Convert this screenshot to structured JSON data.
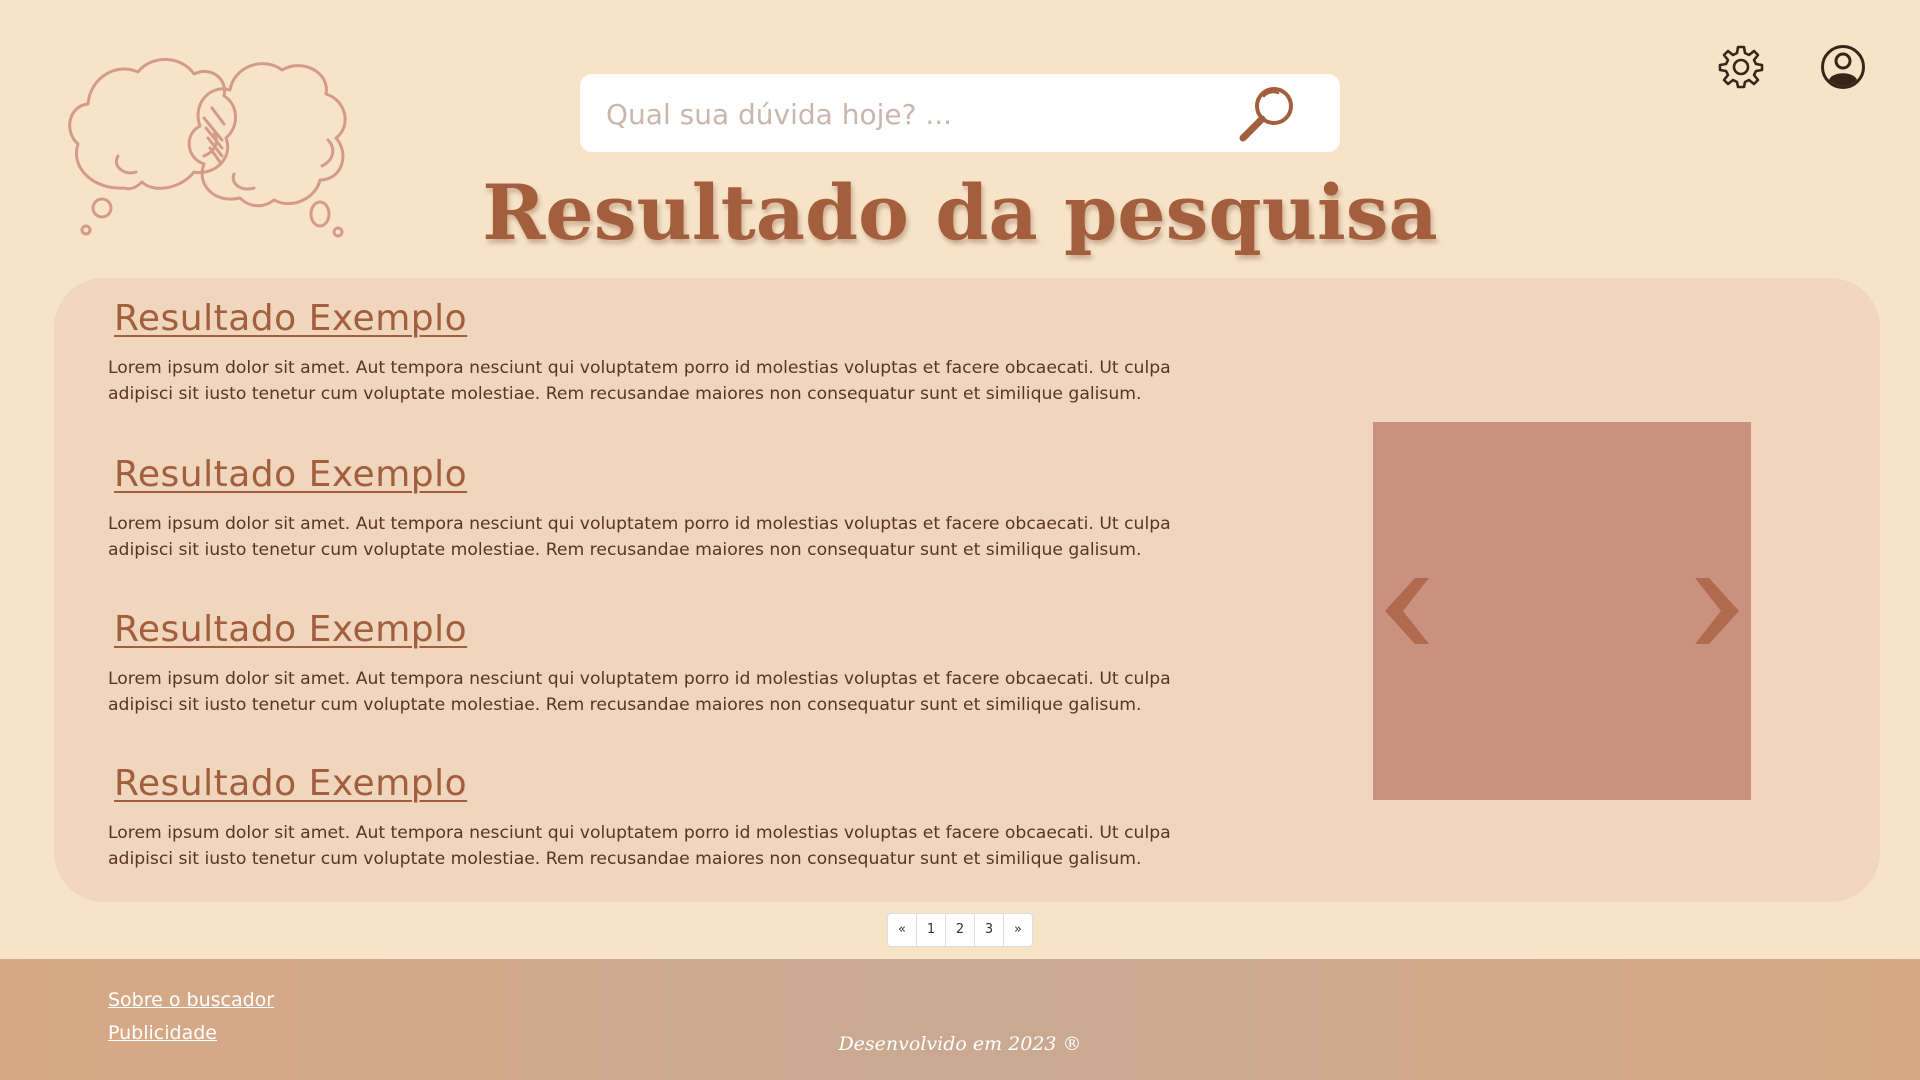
{
  "search": {
    "placeholder": "Qual sua dúvida hoje? ..."
  },
  "header": {
    "title": "Resultado da pesquisa"
  },
  "results": [
    {
      "title": "Resultado Exemplo",
      "text": "Lorem ipsum dolor sit amet. Aut tempora nesciunt qui voluptatem porro id molestias voluptas et facere obcaecati. Ut culpa adipisci sit iusto tenetur cum voluptate molestiae. Rem recusandae maiores non consequatur sunt et similique galisum."
    },
    {
      "title": "Resultado Exemplo",
      "text": "Lorem ipsum dolor sit amet. Aut tempora nesciunt qui voluptatem porro id molestias voluptas et facere obcaecati. Ut culpa adipisci sit iusto tenetur cum voluptate molestiae. Rem recusandae maiores non consequatur sunt et similique galisum."
    },
    {
      "title": "Resultado Exemplo",
      "text": "Lorem ipsum dolor sit amet. Aut tempora nesciunt qui voluptatem porro id molestias voluptas et facere obcaecati. Ut culpa adipisci sit iusto tenetur cum voluptate molestiae. Rem recusandae maiores non consequatur sunt et similique galisum."
    },
    {
      "title": "Resultado Exemplo",
      "text": "Lorem ipsum dolor sit amet. Aut tempora nesciunt qui voluptatem porro id molestias voluptas et facere obcaecati. Ut culpa adipisci sit iusto tenetur cum voluptate molestiae. Rem recusandae maiores non consequatur sunt et similique galisum."
    }
  ],
  "pagination": {
    "prev": "«",
    "pages": [
      "1",
      "2",
      "3"
    ],
    "next": "»"
  },
  "footer": {
    "links": [
      "Sobre o buscador",
      "Publicidade"
    ],
    "credit": "Desenvolvido em 2023 ®"
  },
  "icons": {
    "logo": "thought-bubbles-logo",
    "search": "magnifier-icon",
    "settings": "gear-icon",
    "profile": "user-circle-icon",
    "carousel_prev": "chevron-left-icon",
    "carousel_next": "chevron-right-icon"
  },
  "colors": {
    "background": "#f7e4c8",
    "panel": "#efd6bc",
    "accent": "#a35f3d",
    "text": "#5a3424",
    "carousel": "#cb917f",
    "logo_stroke": "#d49b86",
    "footer": "#d7a984"
  }
}
